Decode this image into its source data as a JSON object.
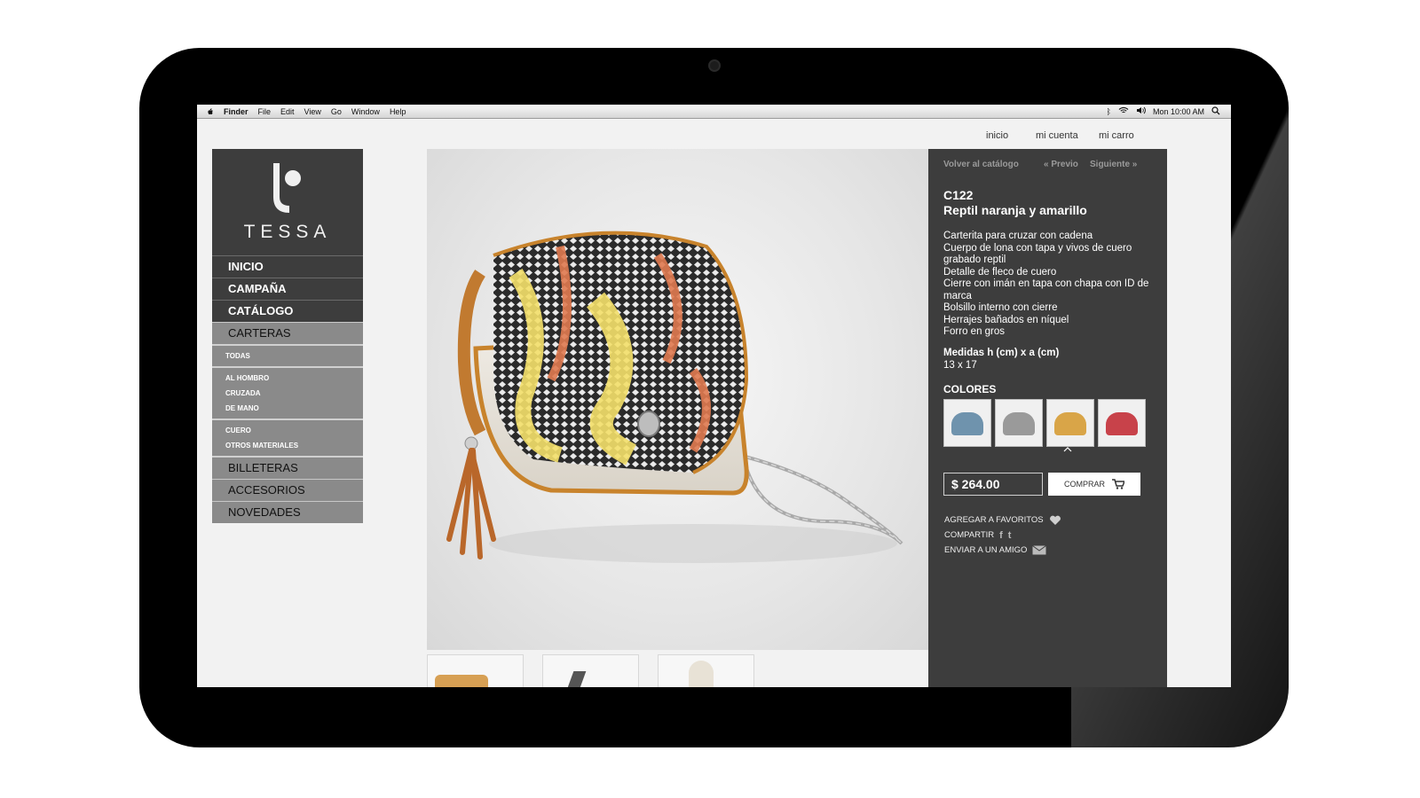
{
  "menubar": {
    "items": [
      "Finder",
      "File",
      "Edit",
      "View",
      "Go",
      "Window",
      "Help"
    ],
    "clock": "Mon 10:00 AM"
  },
  "topnav": {
    "home": "inicio",
    "account": "mi cuenta",
    "cart": "mi carro"
  },
  "brand": {
    "name": "TESSA"
  },
  "sidebar": {
    "main": [
      "INICIO",
      "CAMPAÑA",
      "CATÁLOGO"
    ],
    "category": "CARTERAS",
    "sub_all": "TODAS",
    "sub_group1": [
      "AL HOMBRO",
      "CRUZADA",
      "DE MANO"
    ],
    "sub_group2": [
      "CUERO",
      "OTROS MATERIALES"
    ],
    "more": [
      "BILLETERAS",
      "ACCESORIOS",
      "NOVEDADES"
    ]
  },
  "product": {
    "back": "Volver al catálogo",
    "prev": "« Previo",
    "next": "Siguiente »",
    "code": "C122",
    "title": "Reptil naranja y amarillo",
    "description": [
      "Carterita para cruzar con cadena",
      "Cuerpo de lona con tapa y vivos de cuero grabado reptil",
      "Detalle de fleco de cuero",
      "Cierre con imán en tapa con chapa con ID de marca",
      "Bolsillo interno con cierre",
      "Herrajes bañados en níquel",
      "Forro en gros"
    ],
    "measure_label": "Medidas h (cm) x a (cm)",
    "measure_value": "13 x 17",
    "colors_label": "COLORES",
    "price": "$ 264.00",
    "buy": "COMPRAR",
    "favorite": "AGREGAR A FAVORITOS",
    "share": "COMPARTIR",
    "send": "ENVIAR A UN AMIGO"
  },
  "colors": {
    "panel": "#3d3d3d",
    "sidebar_dark": "#3d3d3d",
    "sidebar_grey": "#8a8a8a",
    "swatch_variants": [
      "#6f93ad",
      "#9a9a9a",
      "#d9a548",
      "#c8424a"
    ]
  }
}
